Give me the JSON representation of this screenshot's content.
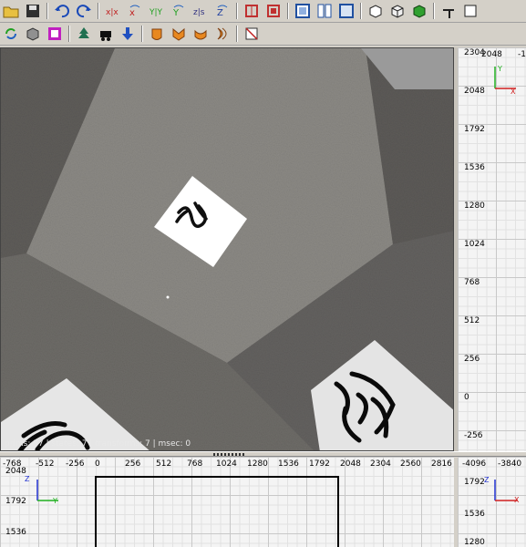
{
  "toolbar1": {
    "xy_label": "X|Y",
    "xz_label": "X|Z",
    "yz_label": "Y|Z"
  },
  "viewport": {
    "status": "prims: 37 | states: 7 | transforms: 7 | msec: 0"
  },
  "side_view": {
    "top_labels": [
      "2304",
      "2048",
      "-1"
    ],
    "y_labels": [
      "2048",
      "1792",
      "1536",
      "1280",
      "1024",
      "768",
      "512",
      "256",
      "0",
      "-256"
    ],
    "axis_v": "Y",
    "axis_h": "X"
  },
  "bottom_view": {
    "x_labels": [
      "-768",
      "-512",
      "-256",
      "0",
      "256",
      "512",
      "768",
      "1024",
      "1280",
      "1536",
      "1792",
      "2048",
      "2304",
      "2560",
      "2816"
    ],
    "y_labels": [
      "2048",
      "1792",
      "1536"
    ],
    "axis_v": "Z",
    "axis_h": "Y"
  },
  "corner_view": {
    "x_labels": [
      "-4096",
      "-3840"
    ],
    "y_labels": [
      "1792",
      "1536",
      "1280"
    ],
    "axis_v": "Z",
    "axis_h": "X"
  }
}
